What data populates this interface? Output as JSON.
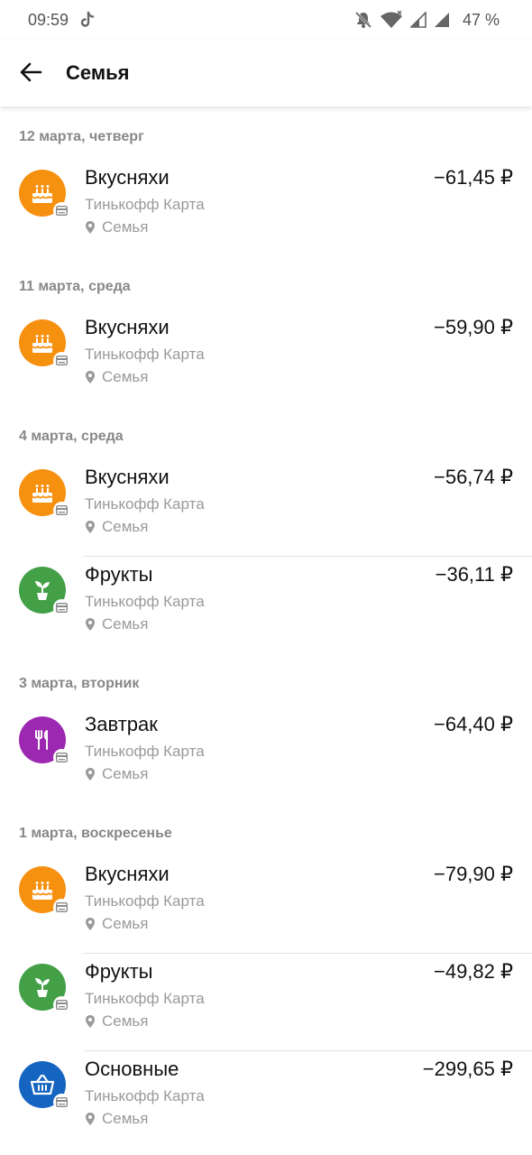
{
  "status_bar": {
    "time": "09:59",
    "battery": "47 %"
  },
  "header": {
    "title": "Семья"
  },
  "colors": {
    "orange": "#F6900F",
    "green": "#43A047",
    "purple": "#9C27B0",
    "blue": "#1565C0",
    "muted": "#9a9a9a"
  },
  "groups": [
    {
      "date": "12 марта, четверг",
      "items": [
        {
          "name": "Вкусняхи",
          "account": "Тинькофф Карта",
          "budget": "Семья",
          "amount": "−61,45 ₽",
          "icon": "cake-icon",
          "color": "#F6900F"
        }
      ]
    },
    {
      "date": "11 марта, среда",
      "items": [
        {
          "name": "Вкусняхи",
          "account": "Тинькофф Карта",
          "budget": "Семья",
          "amount": "−59,90 ₽",
          "icon": "cake-icon",
          "color": "#F6900F"
        }
      ]
    },
    {
      "date": "4 марта, среда",
      "items": [
        {
          "name": "Вкусняхи",
          "account": "Тинькофф Карта",
          "budget": "Семья",
          "amount": "−56,74 ₽",
          "icon": "cake-icon",
          "color": "#F6900F"
        },
        {
          "name": "Фрукты",
          "account": "Тинькофф Карта",
          "budget": "Семья",
          "amount": "−36,11 ₽",
          "icon": "plant-icon",
          "color": "#43A047"
        }
      ]
    },
    {
      "date": "3 марта, вторник",
      "items": [
        {
          "name": "Завтрак",
          "account": "Тинькофф Карта",
          "budget": "Семья",
          "amount": "−64,40 ₽",
          "icon": "cutlery-icon",
          "color": "#9C27B0"
        }
      ]
    },
    {
      "date": "1 марта, воскресенье",
      "items": [
        {
          "name": "Вкусняхи",
          "account": "Тинькофф Карта",
          "budget": "Семья",
          "amount": "−79,90 ₽",
          "icon": "cake-icon",
          "color": "#F6900F"
        },
        {
          "name": "Фрукты",
          "account": "Тинькофф Карта",
          "budget": "Семья",
          "amount": "−49,82 ₽",
          "icon": "plant-icon",
          "color": "#43A047"
        },
        {
          "name": "Основные",
          "account": "Тинькофф Карта",
          "budget": "Семья",
          "amount": "−299,65 ₽",
          "icon": "basket-icon",
          "color": "#1565C0"
        }
      ]
    }
  ]
}
